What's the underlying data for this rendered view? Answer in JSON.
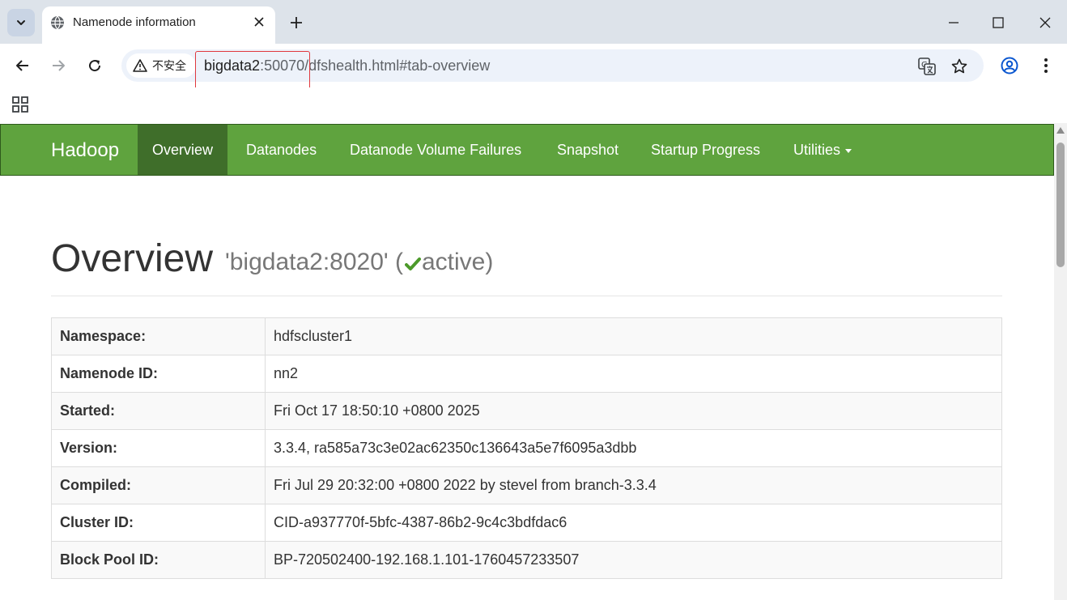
{
  "browser": {
    "tab_title": "Namenode information",
    "security_label": "不安全",
    "url_host": "bigdata2",
    "url_port": ":50070",
    "url_path": "/dfshealth.html#tab-overview"
  },
  "navbar": {
    "brand": "Hadoop",
    "items": [
      {
        "label": "Overview",
        "active": true
      },
      {
        "label": "Datanodes"
      },
      {
        "label": "Datanode Volume Failures"
      },
      {
        "label": "Snapshot"
      },
      {
        "label": "Startup Progress"
      },
      {
        "label": "Utilities"
      }
    ]
  },
  "header": {
    "title": "Overview",
    "address": "'bigdata2:8020'",
    "open_paren": "(",
    "state": "active",
    "close_paren": ")"
  },
  "overview_table": [
    {
      "key": "Namespace:",
      "value": "hdfscluster1"
    },
    {
      "key": "Namenode ID:",
      "value": "nn2"
    },
    {
      "key": "Started:",
      "value": "Fri Oct 17 18:50:10 +0800 2025"
    },
    {
      "key": "Version:",
      "value": "3.3.4, ra585a73c3e02ac62350c136643a5e7f6095a3dbb"
    },
    {
      "key": "Compiled:",
      "value": "Fri Jul 29 20:32:00 +0800 2022 by stevel from branch-3.3.4"
    },
    {
      "key": "Cluster ID:",
      "value": "CID-a937770f-5bfc-4387-86b2-9c4c3bdfdac6"
    },
    {
      "key": "Block Pool ID:",
      "value": "BP-720502400-192.168.1.101-1760457233507"
    }
  ],
  "colors": {
    "navbar": "#5fa33e",
    "navbar_active": "#3f6e2a",
    "active_check": "#4c9a2a",
    "url_highlight": "#e0393e"
  }
}
